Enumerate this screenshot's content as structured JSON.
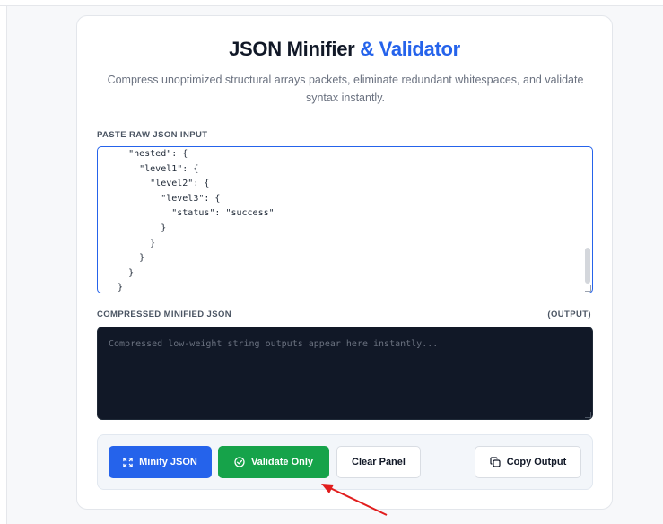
{
  "header": {
    "title_main": "JSON Minifier",
    "title_accent": "& Validator",
    "subtitle": "Compress unoptimized structural arrays packets, eliminate redundant whitespaces, and validate syntax instantly."
  },
  "input": {
    "label": "PASTE RAW JSON INPUT",
    "value": "    \"nested\": {\n      \"level1\": {\n        \"level2\": {\n          \"level3\": {\n            \"status\": \"success\"\n          }\n        }\n      }\n    }\n  }"
  },
  "output": {
    "label": "COMPRESSED MINIFIED JSON",
    "tag": "(OUTPUT)",
    "placeholder": "Compressed low-weight string outputs appear here instantly..."
  },
  "actions": {
    "minify_label": "Minify JSON",
    "validate_label": "Validate Only",
    "clear_label": "Clear Panel",
    "copy_label": "Copy Output"
  },
  "colors": {
    "accent": "#2563eb",
    "validate": "#16a34a",
    "output_bg": "#111827",
    "annotation_arrow": "#e11d1d"
  },
  "icons": {
    "minify": "expand-arrows-icon",
    "validate": "check-circle-icon",
    "copy": "copy-icon"
  }
}
